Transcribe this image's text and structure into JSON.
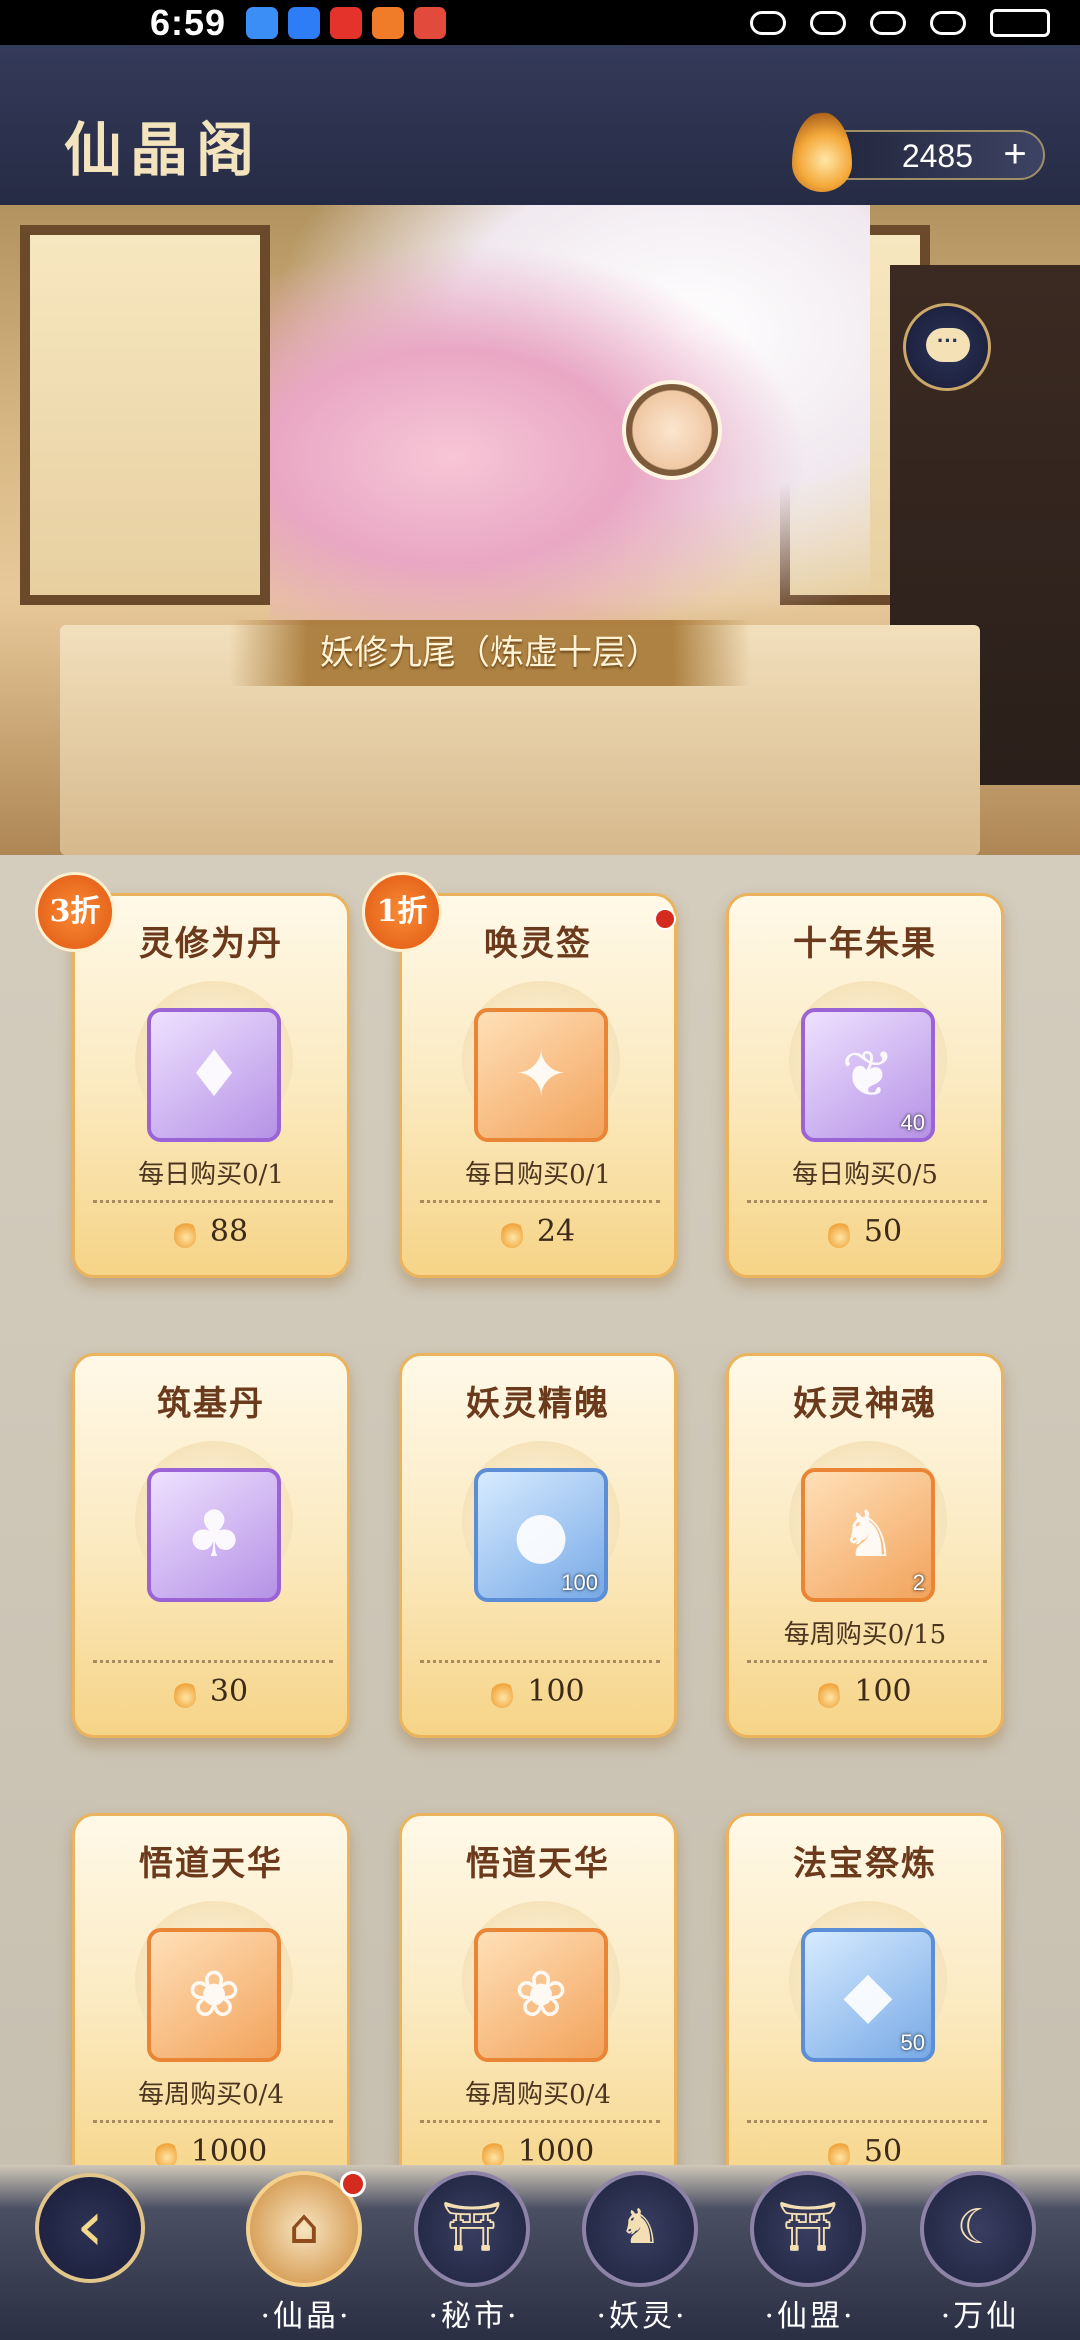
{
  "status_bar": {
    "time": "6:59"
  },
  "header": {
    "title": "仙晶阁",
    "currency_amount": "2485",
    "plus_label": "+"
  },
  "banner": {
    "name_plate": "妖修九尾（炼虚十层）",
    "chat_icon": "···"
  },
  "shop": {
    "cards": [
      {
        "name": "灵修为丹",
        "limit": "每日购买0/1",
        "price": "88",
        "discount": "3折",
        "qty": "",
        "color": "purple"
      },
      {
        "name": "唤灵签",
        "limit": "每日购买0/1",
        "price": "24",
        "discount": "1折",
        "qty": "",
        "color": "orange"
      },
      {
        "name": "十年朱果",
        "limit": "每日购买0/5",
        "price": "50",
        "discount": "",
        "qty": "40",
        "color": "purple"
      },
      {
        "name": "筑基丹",
        "limit": "",
        "price": "30",
        "discount": "",
        "qty": "",
        "color": "purple"
      },
      {
        "name": "妖灵精魄",
        "limit": "",
        "price": "100",
        "discount": "",
        "qty": "100",
        "color": "blue"
      },
      {
        "name": "妖灵神魂",
        "limit": "每周购买0/15",
        "price": "100",
        "discount": "",
        "qty": "2",
        "color": "orange"
      },
      {
        "name": "悟道天华",
        "limit": "每周购买0/4",
        "price": "1000",
        "discount": "",
        "qty": "",
        "color": "orange"
      },
      {
        "name": "悟道天华",
        "limit": "每周购买0/4",
        "price": "1000",
        "discount": "",
        "qty": "",
        "color": "orange"
      },
      {
        "name": "法宝祭炼",
        "limit": "",
        "price": "50",
        "discount": "",
        "qty": "50",
        "color": "blue"
      }
    ]
  },
  "bottom_nav": {
    "back_icon": "‹",
    "items": [
      {
        "label": "·仙晶·",
        "icon": "⌂"
      },
      {
        "label": "·秘市·",
        "icon": "⛩"
      },
      {
        "label": "·妖灵·",
        "icon": "♞"
      },
      {
        "label": "·仙盟·",
        "icon": "⛩"
      },
      {
        "label": "·万仙",
        "icon": "☾"
      }
    ]
  },
  "colors": {
    "accent": "#c7a86a",
    "header_bg": "#2a2f4a",
    "red_dot": "#d52a1e"
  }
}
